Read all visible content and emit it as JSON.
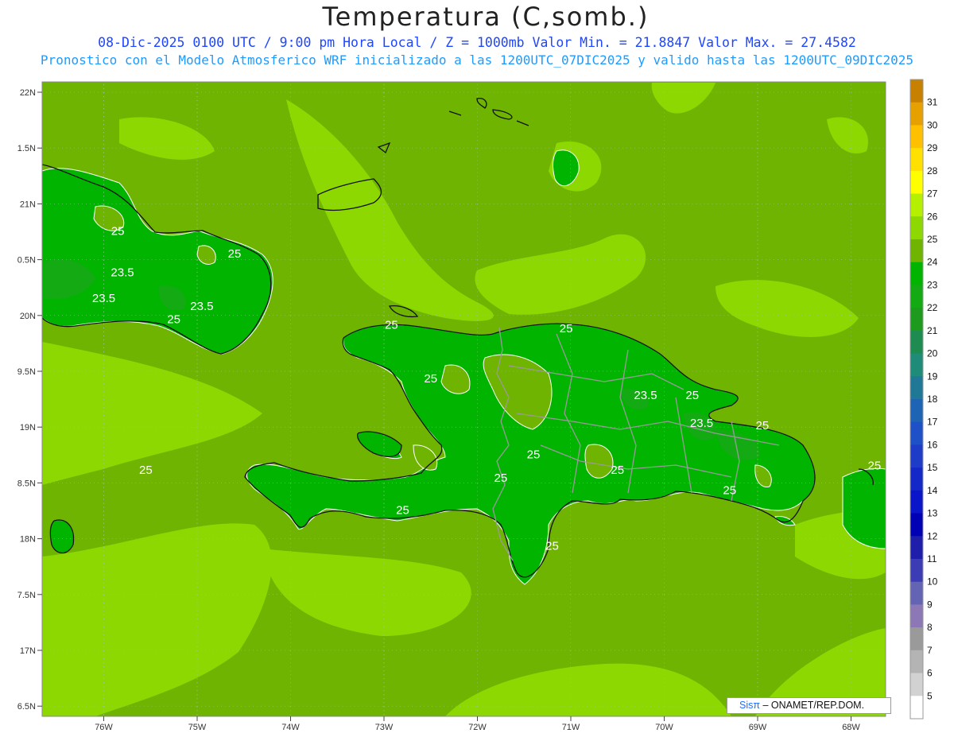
{
  "title": "Temperatura (C,somb.)",
  "subtitle_line1": "08-Dic-2025  0100 UTC / 9:00 pm Hora Local / Z = 1000mb   Valor Min. = 21.8847  Valor Max. = 27.4582",
  "subtitle_line2": "Pronostico con el Modelo Atmosferico WRF inicializado a las 1200UTC_07DIC2025 y valido hasta las  1200UTC_09DIC2025",
  "lat_labels": [
    "22N",
    "1.5N",
    "21N",
    "0.5N",
    "20N",
    "9.5N",
    "19N",
    "8.5N",
    "18N",
    "7.5N",
    "17N",
    "6.5N"
  ],
  "lon_labels": [
    "76W",
    "75W",
    "74W",
    "73W",
    "72W",
    "71W",
    "70W",
    "69W",
    "68W"
  ],
  "colorbar": {
    "labels": [
      "31",
      "30",
      "29",
      "28",
      "27",
      "26",
      "25",
      "24",
      "23",
      "22",
      "21",
      "20",
      "19",
      "18",
      "17",
      "16",
      "15",
      "14",
      "13",
      "12",
      "11",
      "10",
      "9",
      "8",
      "7",
      "6",
      "5"
    ],
    "colors": [
      "#c88000",
      "#e6a000",
      "#ffc000",
      "#ffe000",
      "#ffff00",
      "#b4f000",
      "#8cd800",
      "#6eb400",
      "#00b400",
      "#14aa14",
      "#1e9a1e",
      "#1e8c50",
      "#1e8c78",
      "#1e7896",
      "#1e64b4",
      "#1e50c8",
      "#1e3cc8",
      "#1428c8",
      "#0a14c8",
      "#0000b4",
      "#1e1eaa",
      "#3c3cb4",
      "#6464b4",
      "#8c78b4",
      "#9a9a9a",
      "#b4b4b4",
      "#d2d2d2",
      "#ffffff"
    ]
  },
  "contour_labels": [
    {
      "text": "25",
      "lon": -75.85,
      "lat": 20.72
    },
    {
      "text": "25",
      "lon": -74.6,
      "lat": 20.52
    },
    {
      "text": "23.5",
      "lon": -75.8,
      "lat": 20.35
    },
    {
      "text": "23.5",
      "lon": -76.0,
      "lat": 20.12
    },
    {
      "text": "23.5",
      "lon": -74.95,
      "lat": 20.05
    },
    {
      "text": "25",
      "lon": -75.25,
      "lat": 19.93
    },
    {
      "text": "25",
      "lon": -72.92,
      "lat": 19.88
    },
    {
      "text": "25",
      "lon": -71.05,
      "lat": 19.85
    },
    {
      "text": "25",
      "lon": -72.5,
      "lat": 19.4
    },
    {
      "text": "23.5",
      "lon": -70.2,
      "lat": 19.25
    },
    {
      "text": "25",
      "lon": -69.7,
      "lat": 19.25
    },
    {
      "text": "23.5",
      "lon": -69.6,
      "lat": 19.0
    },
    {
      "text": "25",
      "lon": -68.95,
      "lat": 18.98
    },
    {
      "text": "25",
      "lon": -71.4,
      "lat": 18.72
    },
    {
      "text": "25",
      "lon": -75.55,
      "lat": 18.58
    },
    {
      "text": "25",
      "lon": -71.75,
      "lat": 18.51
    },
    {
      "text": "25",
      "lon": -70.5,
      "lat": 18.58
    },
    {
      "text": "25",
      "lon": -67.75,
      "lat": 18.62
    },
    {
      "text": "25",
      "lon": -69.3,
      "lat": 18.4
    },
    {
      "text": "25",
      "lon": -72.8,
      "lat": 18.22
    },
    {
      "text": "25",
      "lon": -71.2,
      "lat": 17.9
    }
  ],
  "credit": {
    "brand": "Sisπ",
    "text": "– ONAMET/REP.DOM."
  }
}
